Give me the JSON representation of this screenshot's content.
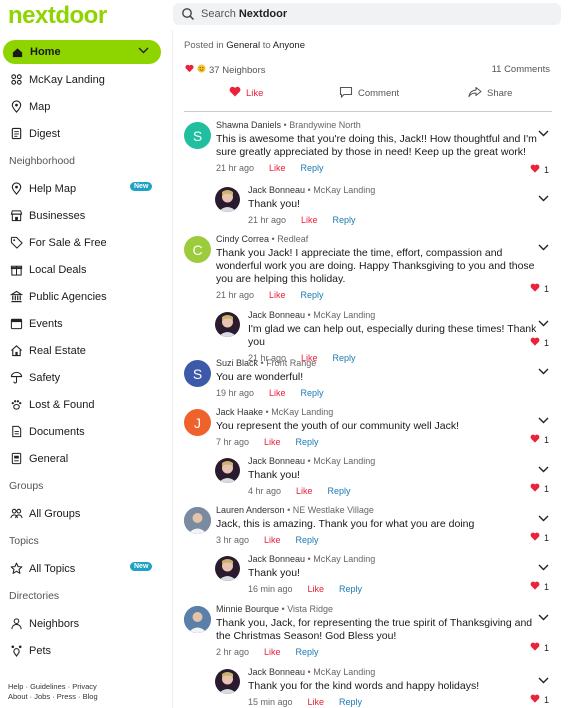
{
  "app": {
    "logo": "nextdoor",
    "brand_color": "#8ed500"
  },
  "search": {
    "prefix": "Search",
    "brand": "Nextdoor"
  },
  "sidebar": {
    "top_items": [
      {
        "label": "Home",
        "icon": "home-icon"
      },
      {
        "label": "McKay Landing",
        "icon": "neighborhood-icon"
      },
      {
        "label": "Map",
        "icon": "map-pin-icon"
      },
      {
        "label": "Digest",
        "icon": "digest-icon"
      }
    ],
    "neighborhood_heading": "Neighborhood",
    "neighborhood_items": [
      {
        "label": "Help Map",
        "icon": "map-pin-icon",
        "badge": "New"
      },
      {
        "label": "Businesses",
        "icon": "store-icon"
      },
      {
        "label": "For Sale & Free",
        "icon": "tag-icon"
      },
      {
        "label": "Local Deals",
        "icon": "gift-icon"
      },
      {
        "label": "Public Agencies",
        "icon": "building-icon"
      },
      {
        "label": "Events",
        "icon": "calendar-icon"
      },
      {
        "label": "Real Estate",
        "icon": "house-icon"
      },
      {
        "label": "Safety",
        "icon": "safety-icon"
      },
      {
        "label": "Lost & Found",
        "icon": "paw-icon"
      },
      {
        "label": "Documents",
        "icon": "document-icon"
      },
      {
        "label": "General",
        "icon": "general-icon"
      }
    ],
    "groups_heading": "Groups",
    "groups_items": [
      {
        "label": "All Groups",
        "icon": "people-icon"
      }
    ],
    "topics_heading": "Topics",
    "topics_items": [
      {
        "label": "All Topics",
        "icon": "star-icon",
        "badge": "New"
      }
    ],
    "directories_heading": "Directories",
    "directories_items": [
      {
        "label": "Neighbors",
        "icon": "person-icon"
      },
      {
        "label": "Pets",
        "icon": "pet-icon"
      }
    ],
    "footer_line1": "Help · Guidelines · Privacy",
    "footer_line2": "About · Jobs · Press · Blog"
  },
  "post": {
    "posted_prefix": "Posted in",
    "posted_in": "General",
    "posted_to_word": "to",
    "posted_to": "Anyone",
    "reaction_count": "37 Neighbors",
    "comment_count": "11 Comments",
    "like_label": "Like",
    "comment_label": "Comment",
    "share_label": "Share",
    "like_color": "#e8233b"
  },
  "labels": {
    "like": "Like",
    "reply": "Reply"
  },
  "comments": [
    {
      "name": "Shawna Daniels",
      "hood": "Brandywine North",
      "text": "This is awesome that you're doing this, Jack!! How thoughtful and I'm sure greatly appreciated by those in need! Keep up the great work!",
      "time": "21 hr ago",
      "likes": "1",
      "initial": "S",
      "avatar_color": "#1fbf9f",
      "reply": false
    },
    {
      "name": "Jack Bonneau",
      "hood": "McKay Landing",
      "text": "Thank you!",
      "time": "21 hr ago",
      "likes": "",
      "reply": true
    },
    {
      "name": "Cindy Correa",
      "hood": "Redleaf",
      "text": "Thank you Jack!  I appreciate the time, effort, compassion and wonderful work you are doing.  Happy Thanksgiving to you and those you are helping this holiday.",
      "time": "21 hr ago",
      "likes": "1",
      "initial": "C",
      "avatar_color": "#9ccc3c",
      "reply": false
    },
    {
      "name": "Jack Bonneau",
      "hood": "McKay Landing",
      "text": "I'm glad we can help out, especially during these times! Thank you",
      "time": "21 hr ago",
      "likes": "1",
      "reply": true
    },
    {
      "name": "Suzi Black",
      "hood": "Front Range",
      "text": "You are wonderful!",
      "time": "19 hr ago",
      "likes": "",
      "initial": "S",
      "avatar_color": "#3d5aa8",
      "reply": false
    },
    {
      "name": "Jack Haake",
      "hood": "McKay Landing",
      "text": "You represent the youth of our community well Jack!",
      "time": "7 hr ago",
      "likes": "1",
      "initial": "J",
      "avatar_color": "#f0622b",
      "reply": false
    },
    {
      "name": "Jack Bonneau",
      "hood": "McKay Landing",
      "text": "Thank you!",
      "time": "4 hr ago",
      "likes": "1",
      "reply": true
    },
    {
      "name": "Lauren Anderson",
      "hood": "NE Westlake Village",
      "text": "Jack, this is amazing. Thank you for what you are doing",
      "time": "3 hr ago",
      "likes": "1",
      "initial": "",
      "avatar_color": "#7a8aa0",
      "reply": false
    },
    {
      "name": "Jack Bonneau",
      "hood": "McKay Landing",
      "text": "Thank you!",
      "time": "16 min ago",
      "likes": "1",
      "reply": true
    },
    {
      "name": "Minnie Bourque",
      "hood": "Vista Ridge",
      "text": "Thank you, Jack, for representing the true spirit of Thanksgiving and the Christmas  Season! God Bless you!",
      "time": "2 hr ago",
      "likes": "1",
      "initial": "",
      "avatar_color": "#5b7fa8",
      "reply": false
    },
    {
      "name": "Jack Bonneau",
      "hood": "McKay Landing",
      "text": "Thank you for the kind words and happy holidays!",
      "time": "15 min ago",
      "likes": "1",
      "reply": true
    }
  ]
}
